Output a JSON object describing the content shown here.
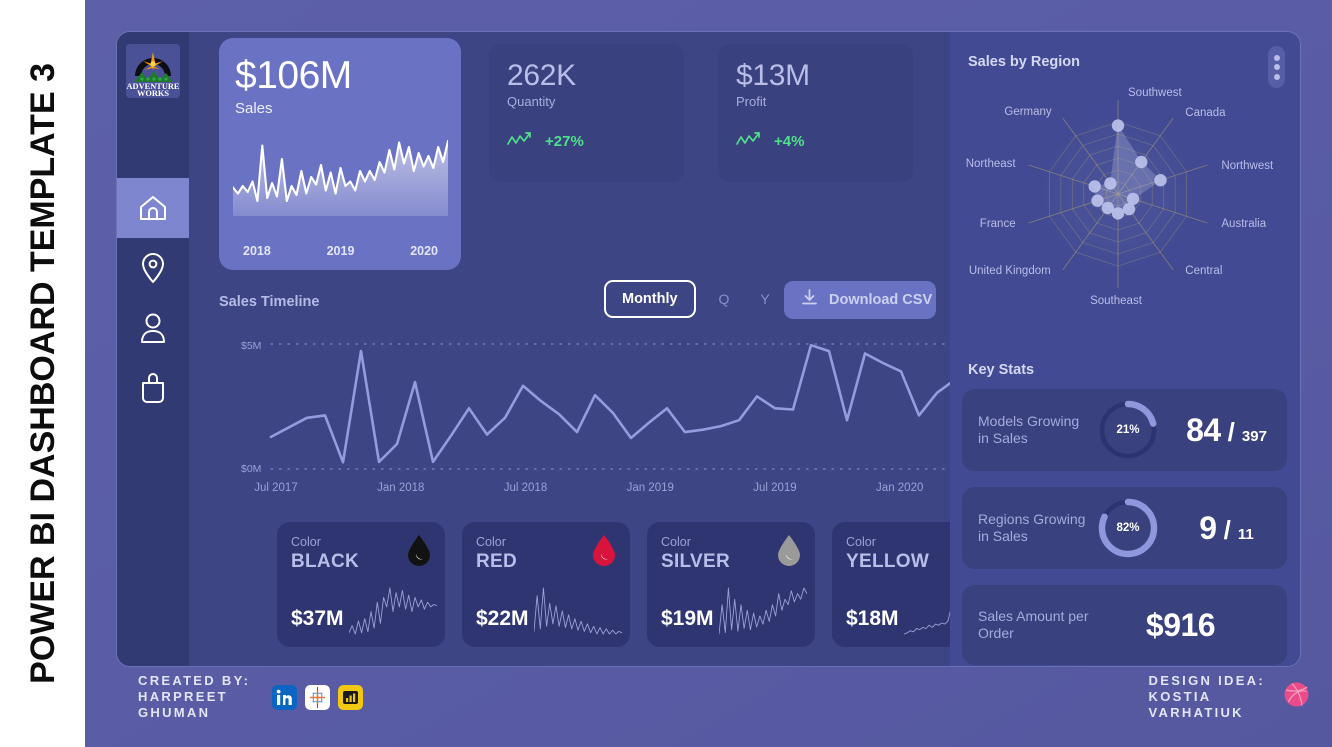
{
  "banner": {
    "title": "POWER BI DASHBOARD TEMPLATE 3"
  },
  "brand": {
    "logo_line1": "ADVENTURE",
    "logo_line2": "WORKS",
    "logo_alt": "adventure-works-logo"
  },
  "sidebar": {
    "items": [
      {
        "icon": "home-icon",
        "name": "home",
        "active": true
      },
      {
        "icon": "location-pin-icon",
        "name": "locations",
        "active": false
      },
      {
        "icon": "user-icon",
        "name": "customers",
        "active": false
      },
      {
        "icon": "bag-icon",
        "name": "products",
        "active": false
      }
    ]
  },
  "kpis": {
    "sales": {
      "value": "$106M",
      "label": "Sales",
      "years": [
        "2018",
        "2019",
        "2020"
      ]
    },
    "quantity": {
      "value": "262K",
      "label": "Quantity",
      "delta": "+27%",
      "delta_color": "#4fe08a",
      "trend_icon": "trend-up-icon"
    },
    "profit": {
      "value": "$13M",
      "label": "Profit",
      "delta": "+4%",
      "delta_color": "#4fe08a",
      "trend_icon": "trend-up-icon"
    }
  },
  "timeline": {
    "title": "Sales Timeline",
    "segments": [
      {
        "label": "Monthly",
        "selected": true
      },
      {
        "label": "Q",
        "selected": false
      },
      {
        "label": "Y",
        "selected": false
      }
    ],
    "download_label": "Download CSV",
    "download_icon": "download-icon"
  },
  "color_cards": [
    {
      "sub": "Color",
      "name": "BLACK",
      "amount": "$37M",
      "swatch": "#121212",
      "icon": "droplet-icon"
    },
    {
      "sub": "Color",
      "name": "RED",
      "amount": "$22M",
      "swatch": "#d9143c",
      "icon": "droplet-icon"
    },
    {
      "sub": "Color",
      "name": "SILVER",
      "amount": "$19M",
      "swatch": "#9a9a9a",
      "icon": "droplet-icon"
    },
    {
      "sub": "Color",
      "name": "YELLOW",
      "amount": "$18M",
      "swatch": "#f2cb05",
      "icon": "droplet-icon"
    }
  ],
  "region_panel": {
    "title": "Sales by Region",
    "menu_icon": "kebab-menu-icon"
  },
  "key_stats": {
    "title": "Key Stats",
    "cards": [
      {
        "label": "Models Growing in Sales",
        "percent": "21%",
        "pct_value": 21,
        "numerator": "84",
        "separator": "/",
        "denominator": "397"
      },
      {
        "label": "Regions Growing in Sales",
        "percent": "82%",
        "pct_value": 82,
        "numerator": "9",
        "separator": "/",
        "denominator": "11"
      },
      {
        "label": "Sales Amount per Order",
        "value": "$916"
      }
    ]
  },
  "footer": {
    "created_by": "CREATED BY:\nHARPREET\nGHUMAN",
    "design_idea": "DESIGN IDEA:\nKOSTIA\nVARHATIUK",
    "social": [
      {
        "name": "linkedin-icon",
        "color": "#0a66c2"
      },
      {
        "name": "tableau-icon",
        "color": "#ffffff"
      },
      {
        "name": "powerbi-icon",
        "color": "#f2c811"
      }
    ],
    "dribbble_icon": {
      "name": "dribbble-icon",
      "color": "#ea4c89"
    }
  },
  "theme": {
    "page_bg": "#5a5da6",
    "shell_bg": "#3d4585",
    "sidebar_bg": "#323a73",
    "right_panel_bg": "#414a92",
    "card_bg": "#39417e",
    "accent": "#6a72c4",
    "accent_light": "#8f97dd",
    "text_primary": "#ffffff",
    "text_muted": "#a5abdd",
    "positive": "#4fe08a"
  },
  "chart_data": [
    {
      "type": "area",
      "title": "Sales",
      "xlabel": "",
      "ylabel": "",
      "tick_labels": [
        "2018",
        "2019",
        "2020"
      ],
      "grid": false,
      "legend": "none",
      "values": [
        1.9,
        1.5,
        2.0,
        1.6,
        2.3,
        1.0,
        4.7,
        1.2,
        2.2,
        1.3,
        3.8,
        1.0,
        2.0,
        1.4,
        3.0,
        1.5,
        2.6,
        2.1,
        3.4,
        1.7,
        2.9,
        1.5,
        3.2,
        2.0,
        2.3,
        1.7,
        3.0,
        2.3,
        3.0,
        2.4,
        3.6,
        2.9,
        4.4,
        3.1,
        4.9,
        3.5,
        4.6,
        3.0,
        4.2,
        3.3,
        4.0,
        3.2,
        4.6,
        3.6,
        5.0
      ],
      "ylim": [
        0,
        5.2
      ]
    },
    {
      "type": "line",
      "title": "Sales Timeline",
      "xlabel": "",
      "ylabel": "",
      "ytick_labels": [
        "$0M",
        "$5M"
      ],
      "ylim": [
        0,
        5
      ],
      "xtick_labels": [
        "Jul 2017",
        "Jan 2018",
        "Jul 2018",
        "Jan 2019",
        "Jul 2019",
        "Jan 2020"
      ],
      "grid": true,
      "legend": "none",
      "series": [
        {
          "name": "Sales",
          "values": [
            1.35,
            1.75,
            2.15,
            2.25,
            0.28,
            4.95,
            0.3,
            1.05,
            3.65,
            0.3,
            1.4,
            2.55,
            1.45,
            2.15,
            3.5,
            2.85,
            2.3,
            1.55,
            3.1,
            2.35,
            1.3,
            1.95,
            2.55,
            1.55,
            1.65,
            1.8,
            2.05,
            3.05,
            2.55,
            2.5,
            5.2,
            4.95,
            2.05,
            4.85,
            4.45,
            4.1,
            2.25,
            3.2,
            3.75,
            3.3,
            3.55,
            5.25
          ]
        }
      ]
    },
    {
      "type": "radar",
      "title": "Sales by Region",
      "legend": "none",
      "categories": [
        "Southwest",
        "Canada",
        "Northwest",
        "Australia",
        "Central",
        "Southeast",
        "United Kingdom",
        "France",
        "Northeast",
        "Germany"
      ],
      "values": [
        0.95,
        0.55,
        0.62,
        0.22,
        0.26,
        0.27,
        0.24,
        0.3,
        0.34,
        0.18
      ],
      "ylim": [
        0,
        1
      ]
    },
    {
      "type": "donut",
      "title": "Models Growing in Sales",
      "values": [
        21,
        79
      ],
      "labels": [
        "Growing",
        "Remaining"
      ],
      "center_label": "21%"
    },
    {
      "type": "donut",
      "title": "Regions Growing in Sales",
      "values": [
        82,
        18
      ],
      "labels": [
        "Growing",
        "Remaining"
      ],
      "center_label": "82%"
    },
    {
      "type": "line",
      "title": "BLACK sparkline",
      "legend": "none",
      "values": [
        4,
        10,
        3,
        14,
        4,
        16,
        5,
        22,
        8,
        30,
        12,
        34,
        26,
        42,
        22,
        38,
        26,
        40,
        24,
        36,
        22,
        34,
        26,
        32,
        24,
        30,
        26,
        28,
        27
      ]
    },
    {
      "type": "line",
      "title": "RED sparkline",
      "legend": "none",
      "values": [
        6,
        34,
        8,
        40,
        10,
        28,
        12,
        26,
        10,
        22,
        9,
        19,
        8,
        16,
        7,
        14,
        6,
        12,
        5,
        10,
        4,
        9,
        4,
        8,
        4,
        7,
        4,
        6,
        5
      ]
    },
    {
      "type": "line",
      "title": "SILVER sparkline",
      "legend": "none",
      "values": [
        5,
        26,
        6,
        38,
        8,
        30,
        7,
        26,
        9,
        22,
        8,
        20,
        10,
        18,
        12,
        22,
        14,
        26,
        18,
        34,
        22,
        30,
        26,
        36,
        28,
        34,
        30,
        38,
        34
      ]
    },
    {
      "type": "line",
      "title": "YELLOW sparkline",
      "legend": "none",
      "values": [
        6,
        7,
        9,
        8,
        11,
        10,
        12,
        11,
        14,
        12,
        15,
        14,
        16,
        15,
        18,
        30,
        34,
        30,
        38,
        34,
        40,
        32,
        42,
        36,
        44,
        38,
        46,
        40,
        48
      ]
    }
  ]
}
